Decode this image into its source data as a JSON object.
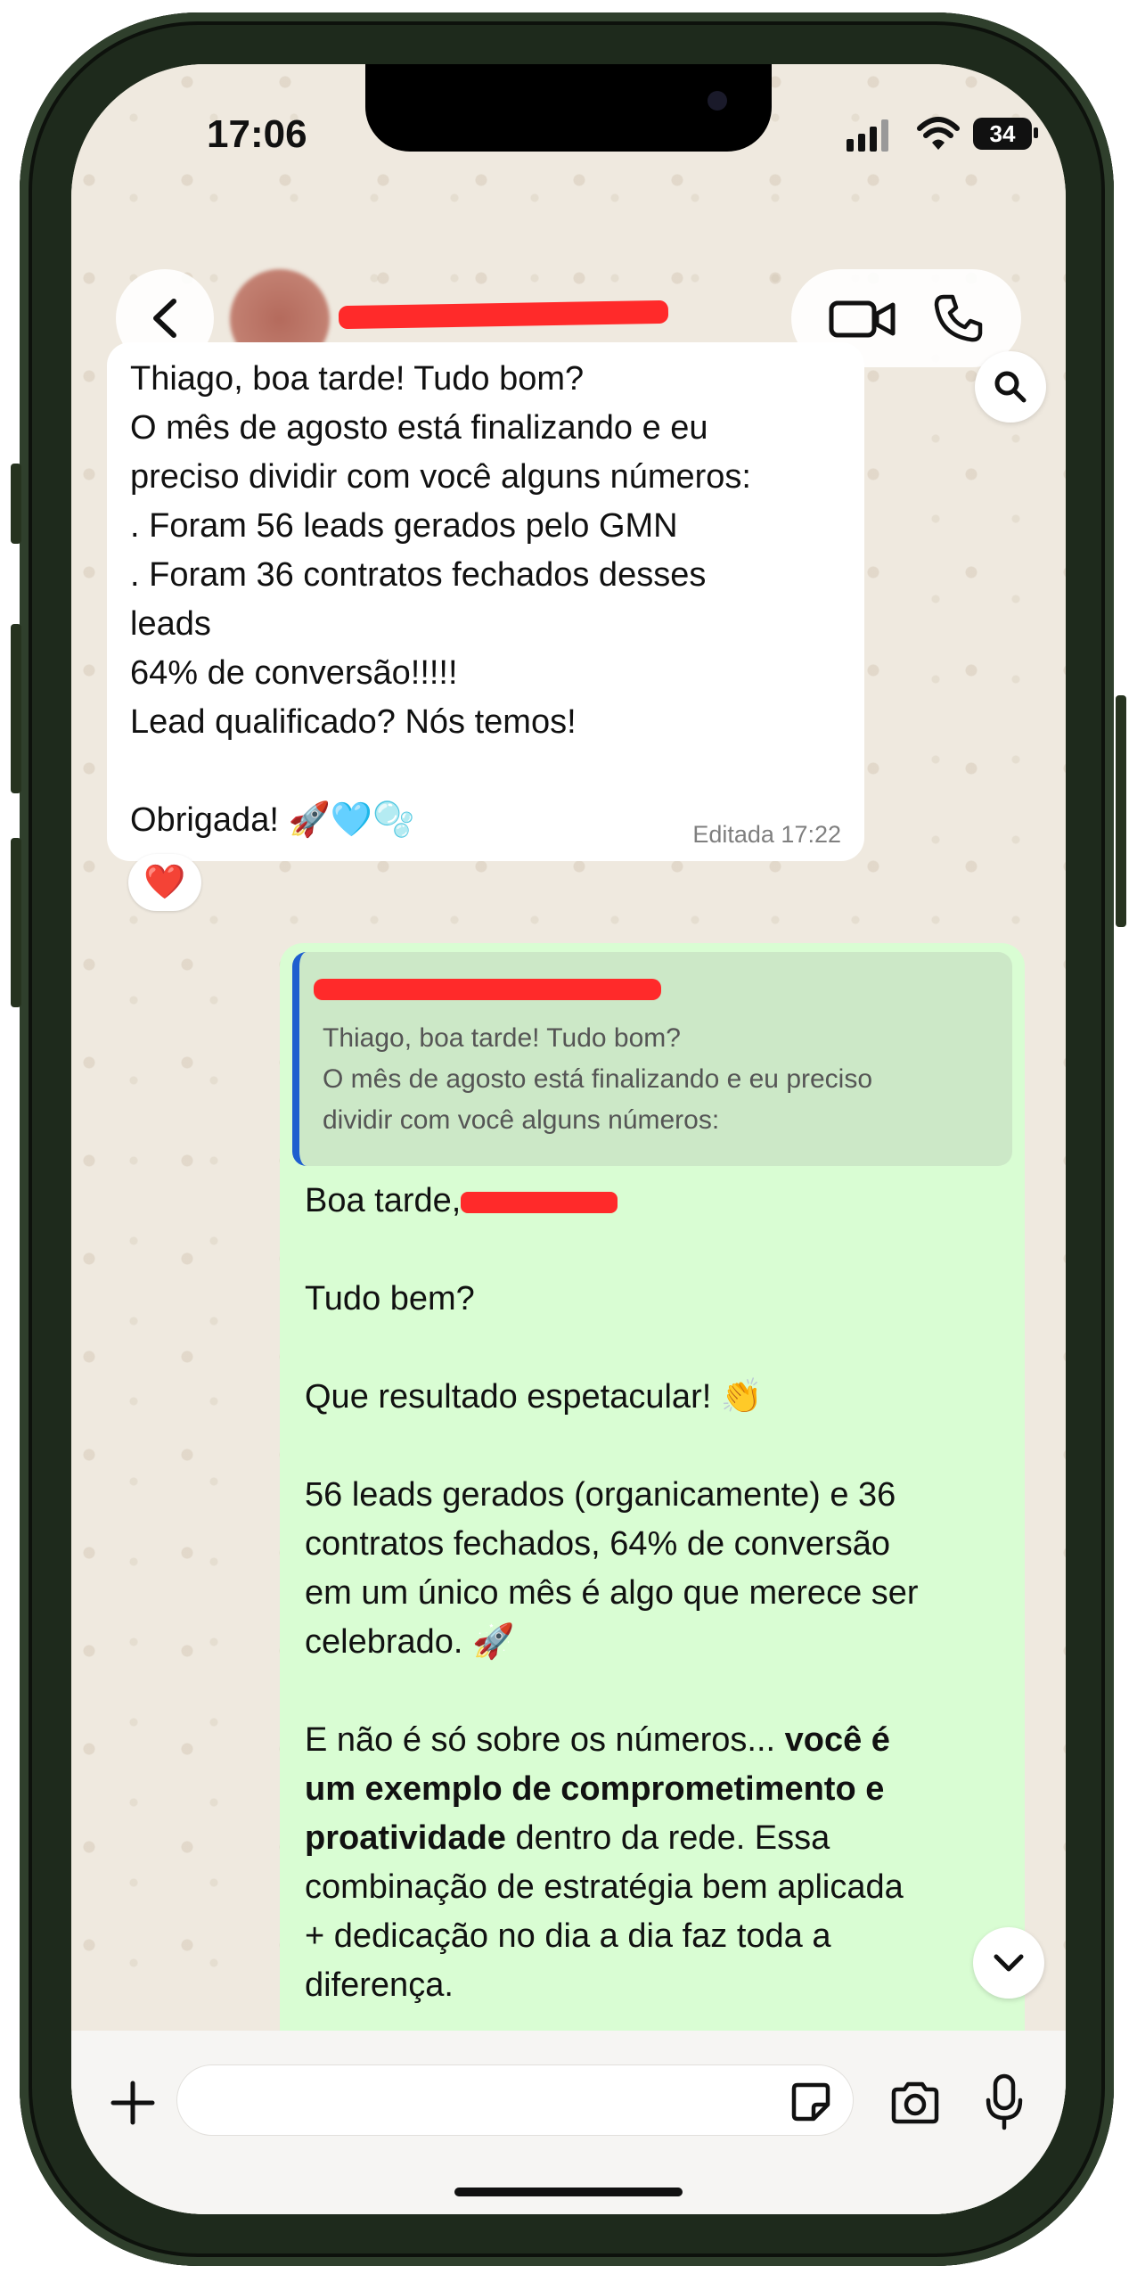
{
  "status_bar": {
    "time": "17:06",
    "battery": "34"
  },
  "chat": {
    "incoming": {
      "text": "Thiago, boa tarde! Tudo bom?\nO mês de agosto está finalizando e eu\npreciso dividir com você alguns números:\n. Foram 56 leads gerados pelo GMN\n. Foram 36 contratos fechados desses\nleads\n64% de conversão!!!!!\nLead qualificado? Nós temos!\n\nObrigada! 🚀🩵🫧",
      "meta": "Editada 17:22",
      "reaction": "❤️"
    },
    "outgoing": {
      "quote_text": "Thiago, boa tarde! Tudo bom?\nO mês de agosto está finalizando e eu preciso\ndividir com você alguns números:",
      "greeting": "Boa tarde,",
      "p1": "Tudo bem?",
      "p2": "Que resultado espetacular! 👏",
      "p3": "56 leads gerados (organicamente) e 36\ncontratos fechados, 64% de conversão\nem um único mês é algo que merece ser\ncelebrado. 🚀",
      "p4_start": "E não é só sobre os números... ",
      "p4_bold": "você é\num exemplo de comprometimento e\nproatividade",
      "p4_end": " dentro da rede. Essa\ncombinação de estratégia bem aplicada\n+ dedicação no dia a dia faz toda a\ndiferença."
    }
  },
  "composer": {
    "placeholder": ""
  },
  "icons": {
    "back": "chevron-left-icon",
    "video": "video-camera-icon",
    "phone": "phone-icon",
    "search": "search-icon",
    "scroll": "chevron-down-icon",
    "plus": "plus-icon",
    "sticker": "sticker-icon",
    "camera": "camera-icon",
    "mic": "microphone-icon"
  },
  "colors": {
    "incoming_bubble": "#ffffff",
    "outgoing_bubble": "#d9fdd3",
    "quote_bar": "#1f5fcf",
    "redaction": "#ff2a2a"
  }
}
